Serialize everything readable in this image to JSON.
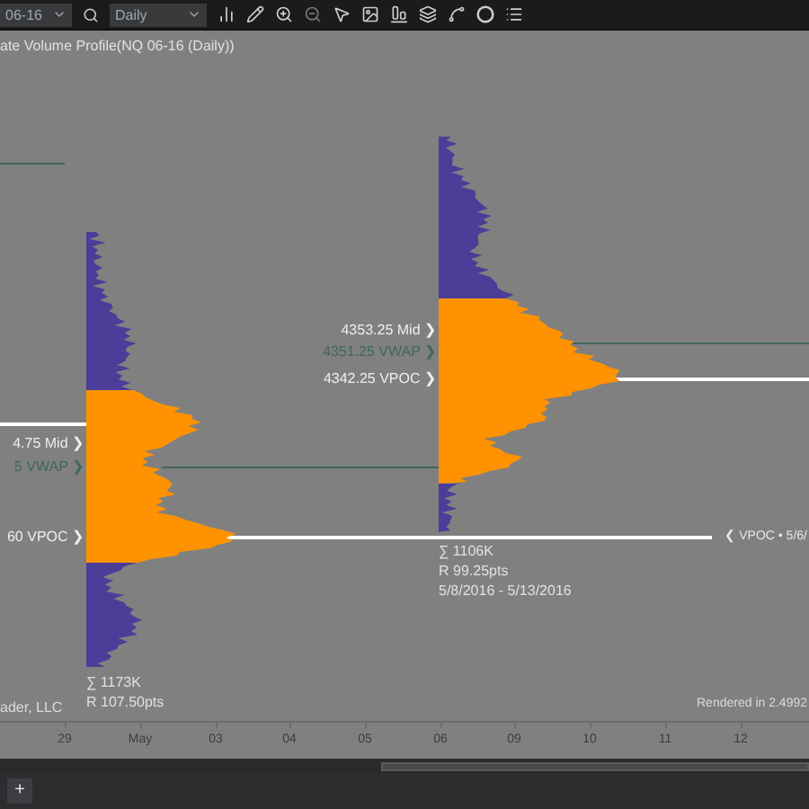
{
  "toolbar": {
    "instrument": "06-16",
    "interval": "Daily"
  },
  "chart": {
    "title": "ate Volume Profile(NQ 06-16 (Daily))",
    "profiles": [
      {
        "labels": [
          {
            "kind": "mid",
            "text": "4.75 Mid ❯"
          },
          {
            "kind": "vwap",
            "text": "5 VWAP ❯"
          },
          {
            "kind": "vpoc",
            "text": "60 VPOC ❯"
          }
        ],
        "stats": [
          "∑ 1173K",
          "R 107.50pts"
        ]
      },
      {
        "labels": [
          {
            "kind": "mid",
            "text": "4353.25 Mid ❯"
          },
          {
            "kind": "vwap",
            "text": "4351.25 VWAP ❯"
          },
          {
            "kind": "vpoc",
            "text": "4342.25 VPOC ❯"
          }
        ],
        "stats": [
          "∑ 1106K",
          "R 99.25pts",
          "5/8/2016 - 5/13/2016"
        ]
      }
    ],
    "vpoc_extension_label": "❮ VPOC • 5/6/",
    "credit": "ader, LLC",
    "render_time": "Rendered in 2.4992"
  },
  "x_axis": {
    "labels": [
      "29",
      "May",
      "03",
      "04",
      "05",
      "06",
      "09",
      "10",
      "11",
      "12"
    ]
  },
  "tab_bar": {
    "add_button": "+"
  }
}
